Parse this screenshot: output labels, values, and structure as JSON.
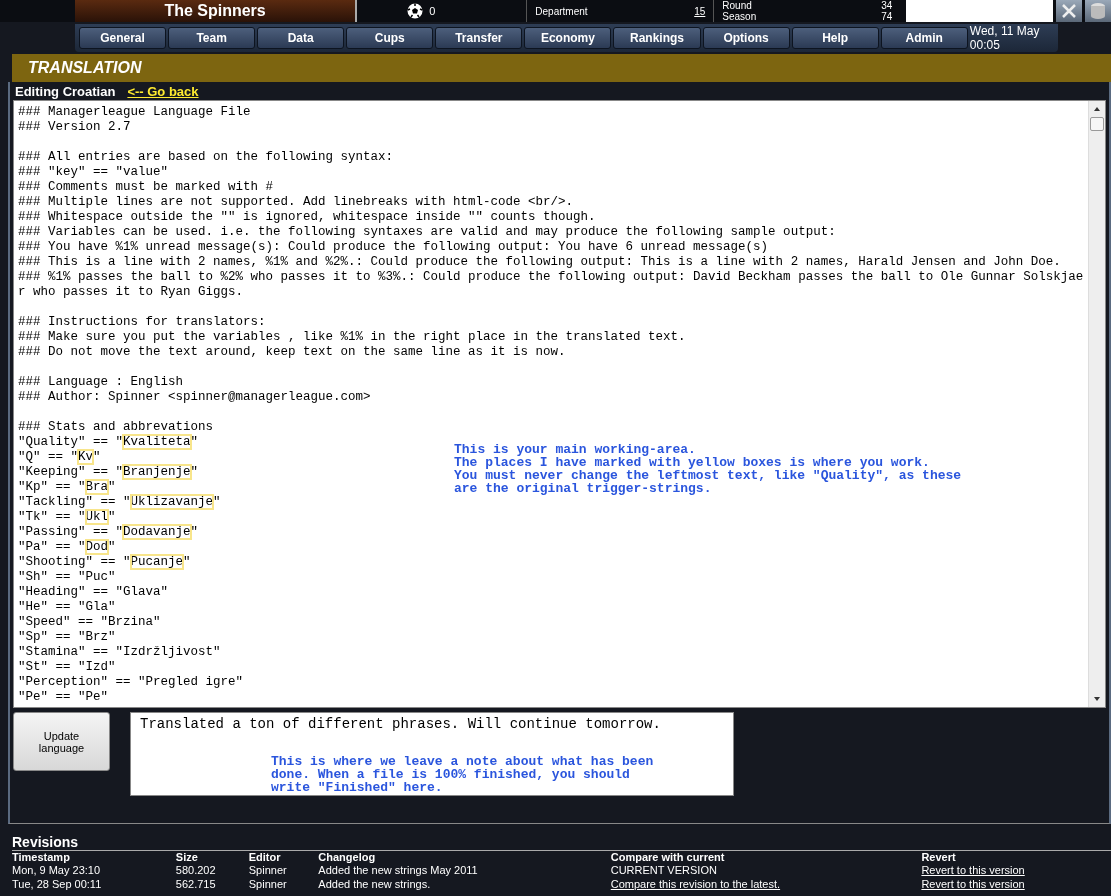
{
  "header": {
    "team_name": "The Spinners",
    "ball_count": "0",
    "stats": [
      {
        "label": "Department",
        "value": "15"
      },
      {
        "label": "Round",
        "value": "34"
      },
      {
        "label": "Season",
        "value": "74"
      }
    ]
  },
  "nav": {
    "tabs": [
      {
        "label": "General"
      },
      {
        "label": "Team"
      },
      {
        "label": "Data"
      },
      {
        "label": "Cups"
      },
      {
        "label": "Transfer"
      },
      {
        "label": "Economy"
      },
      {
        "label": "Rankings"
      },
      {
        "label": "Options"
      },
      {
        "label": "Help"
      },
      {
        "label": "Admin"
      }
    ],
    "datetime": "Wed, 11 May 00:05"
  },
  "section_title": "TRANSLATION",
  "editing_label": "Editing Croatian",
  "back_link": "<-- Go back",
  "editor": {
    "lines": [
      {
        "kind": "text",
        "text": "### Managerleague Language File"
      },
      {
        "kind": "text",
        "text": "### Version 2.7"
      },
      {
        "kind": "blank"
      },
      {
        "kind": "text",
        "text": "### All entries are based on the following syntax:"
      },
      {
        "kind": "text",
        "text": "### \"key\" == \"value\""
      },
      {
        "kind": "text",
        "text": "### Comments must be marked with #"
      },
      {
        "kind": "text",
        "text": "### Multiple lines are not supported. Add linebreaks with html-code <br/>."
      },
      {
        "kind": "text",
        "text": "### Whitespace outside the \"\" is ignored, whitespace inside \"\" counts though."
      },
      {
        "kind": "text",
        "text": "### Variables can be used. i.e. the following syntaxes are valid and may produce the following sample output:"
      },
      {
        "kind": "text",
        "text": "### You have %1% unread message(s): Could produce the following output: You have 6 unread message(s)"
      },
      {
        "kind": "text",
        "text": "### This is a line with 2 names, %1% and %2%.: Could produce the following output: This is a line with 2 names, Harald Jensen and John Doe."
      },
      {
        "kind": "text",
        "text": "### %1% passes the ball to %2% who passes it to %3%.: Could produce the following output: David Beckham passes the ball to Ole Gunnar Solskjaer who passes it to Ryan Giggs."
      },
      {
        "kind": "blank"
      },
      {
        "kind": "text",
        "text": "### Instructions for translators:"
      },
      {
        "kind": "text",
        "text": "### Make sure you put the variables , like %1% in the right place in the translated text."
      },
      {
        "kind": "text",
        "text": "### Do not move the text around, keep text on the same line as it is now."
      },
      {
        "kind": "blank"
      },
      {
        "kind": "text",
        "text": "### Language : English"
      },
      {
        "kind": "text",
        "text": "### Author: Spinner <spinner@managerleague.com>"
      },
      {
        "kind": "blank"
      },
      {
        "kind": "text",
        "text": "### Stats and abbrevations"
      },
      {
        "kind": "entry",
        "before": "\"Quality\" == \"",
        "value": "Kvaliteta",
        "after": "\"",
        "highlighted": true
      },
      {
        "kind": "entry",
        "before": "\"Q\" == \"",
        "value": "Kv",
        "after": "\"",
        "highlighted": true
      },
      {
        "kind": "entry",
        "before": "\"Keeping\" == \"",
        "value": "Branjenje",
        "after": "\"",
        "highlighted": true
      },
      {
        "kind": "entry",
        "before": "\"Kp\" == \"",
        "value": "Bra",
        "after": "\"",
        "highlighted": true
      },
      {
        "kind": "entry",
        "before": "\"Tackling\" == \"",
        "value": "Uklizavanje",
        "after": "\"",
        "highlighted": true
      },
      {
        "kind": "entry",
        "before": "\"Tk\" == \"",
        "value": "Ukl",
        "after": "\"",
        "highlighted": true
      },
      {
        "kind": "entry",
        "before": "\"Passing\" == \"",
        "value": "Dodavanje",
        "after": "\"",
        "highlighted": true
      },
      {
        "kind": "entry",
        "before": "\"Pa\" == \"",
        "value": "Dod",
        "after": "\"",
        "highlighted": true
      },
      {
        "kind": "entry",
        "before": "\"Shooting\" == \"",
        "value": "Pucanje",
        "after": "\"",
        "highlighted": true
      },
      {
        "kind": "entry",
        "before": "\"Sh\" == \"",
        "value": "Puc",
        "after": "\"",
        "highlighted": false
      },
      {
        "kind": "entry",
        "before": "\"Heading\" == \"",
        "value": "Glava",
        "after": "\"",
        "highlighted": false
      },
      {
        "kind": "entry",
        "before": "\"He\" == \"",
        "value": "Gla",
        "after": "\"",
        "highlighted": false
      },
      {
        "kind": "entry",
        "before": "\"Speed\" == \"",
        "value": "Brzina",
        "after": "\"",
        "highlighted": false
      },
      {
        "kind": "entry",
        "before": "\"Sp\" == \"",
        "value": "Brz",
        "after": "\"",
        "highlighted": false
      },
      {
        "kind": "entry",
        "before": "\"Stamina\" == \"",
        "value": "Izdržljivost",
        "after": "\"",
        "highlighted": false
      },
      {
        "kind": "entry",
        "before": "\"St\" == \"",
        "value": "Izd",
        "after": "\"",
        "highlighted": false
      },
      {
        "kind": "entry",
        "before": "\"Perception\" == \"",
        "value": "Pregled igre",
        "after": "\"",
        "highlighted": false
      },
      {
        "kind": "entry",
        "before": "\"Pe\" == \"",
        "value": "Pe",
        "after": "\"",
        "highlighted": false
      }
    ],
    "annotation": [
      "This is your main working-area.",
      "The places I have marked with yellow boxes is where you work.",
      "You must never change the leftmost text, like \"Quality\", as these",
      "are the original trigger-strings."
    ]
  },
  "update_button": "Update language",
  "note": {
    "value": "Translated a ton of different phrases. Will continue tomorrow.",
    "annotation": [
      "This is where we leave a note about what has been",
      "done. When a file is 100% finished, you should",
      "write \"Finished\" here."
    ]
  },
  "revisions": {
    "title": "Revisions",
    "columns": [
      "Timestamp",
      "Size",
      "Editor",
      "Changelog",
      "Compare with current",
      "Revert"
    ],
    "rows": [
      {
        "timestamp": "Mon, 9 May 23:10",
        "size": "580.202",
        "editor": "Spinner",
        "changelog": "Added the new strings May 2011",
        "compare": "CURRENT VERSION",
        "compare_is_link": false,
        "revert": "Revert to this version"
      },
      {
        "timestamp": "Tue, 28 Sep 00:11",
        "size": "562.715",
        "editor": "Spinner",
        "changelog": "Added the new strings.",
        "compare": "Compare this revision to the latest.",
        "compare_is_link": true,
        "revert": "Revert to this version"
      }
    ]
  }
}
